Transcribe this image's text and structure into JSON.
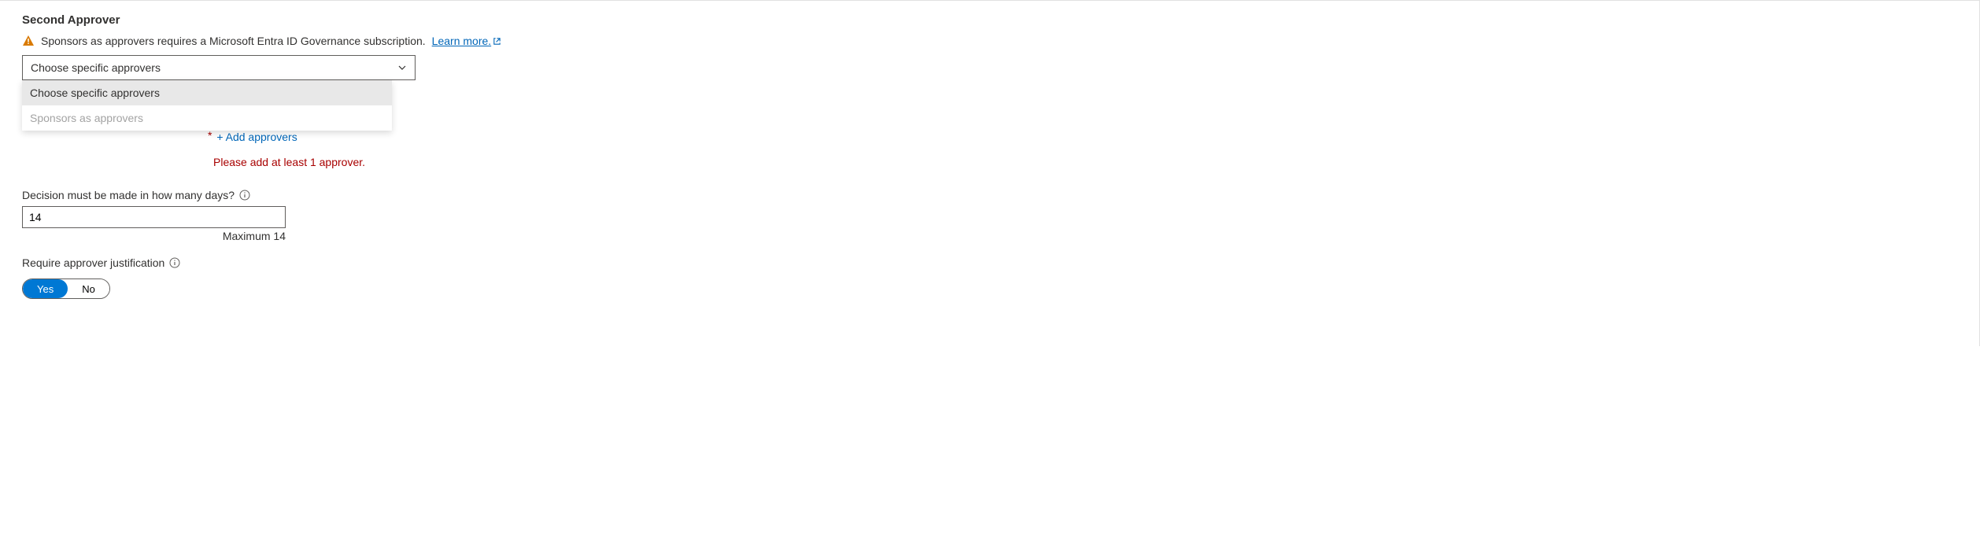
{
  "section": {
    "title": "Second Approver",
    "warning_text": "Sponsors as approvers requires a Microsoft Entra ID Governance subscription.",
    "learn_more": "Learn more."
  },
  "approver_dropdown": {
    "selected": "Choose specific approvers",
    "options": {
      "opt_specific": "Choose specific approvers",
      "opt_sponsors": "Sponsors as approvers"
    }
  },
  "add_approvers": {
    "star": "*",
    "label": "+ Add approvers",
    "error": "Please add at least 1 approver."
  },
  "decision_days": {
    "label": "Decision must be made in how many days?",
    "value": "14",
    "max_hint": "Maximum 14"
  },
  "justification": {
    "label": "Require approver justification",
    "yes": "Yes",
    "no": "No"
  }
}
